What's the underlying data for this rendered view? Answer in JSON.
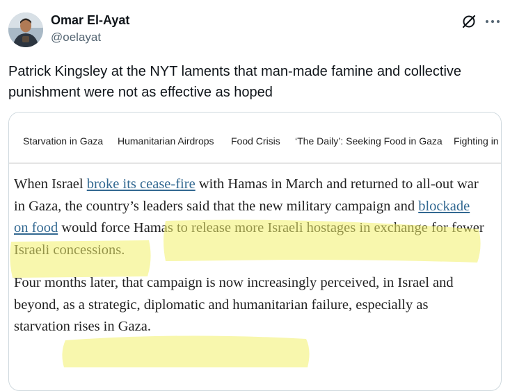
{
  "author": {
    "name": "Omar El-Ayat",
    "handle": "@oelayat"
  },
  "tweet": {
    "text": "Patrick Kingsley at the NYT laments that man-made famine and collective punishment were not as effective as hoped"
  },
  "media": {
    "topics": [
      "Starvation in Gaza",
      "Humanitarian Airdrops",
      "Food Crisis",
      "‘The Daily’: Seeking Food in Gaza",
      "Fighting in"
    ],
    "article": {
      "p1_before_link1": "When Israel ",
      "p1_link1": "broke its cease-fire",
      "p1_mid": " with Hamas in March and returned to all-out war in Gaza, the country’s leaders said that the new military campaign and ",
      "p1_link2": "blockade on food",
      "p1_after": " would force Hamas to release more Israeli hostages in exchange for fewer Israeli concessions.",
      "p2": "Four months later, that campaign is now increasingly perceived, in Israel and beyond, as a strategic, diplomatic and humanitarian failure, especially as starvation rises in Gaza."
    }
  },
  "colors": {
    "link": "#326891",
    "highlight": "#f2f06a",
    "handle": "#536471"
  },
  "icons": [
    "grok-icon",
    "more-icon"
  ]
}
